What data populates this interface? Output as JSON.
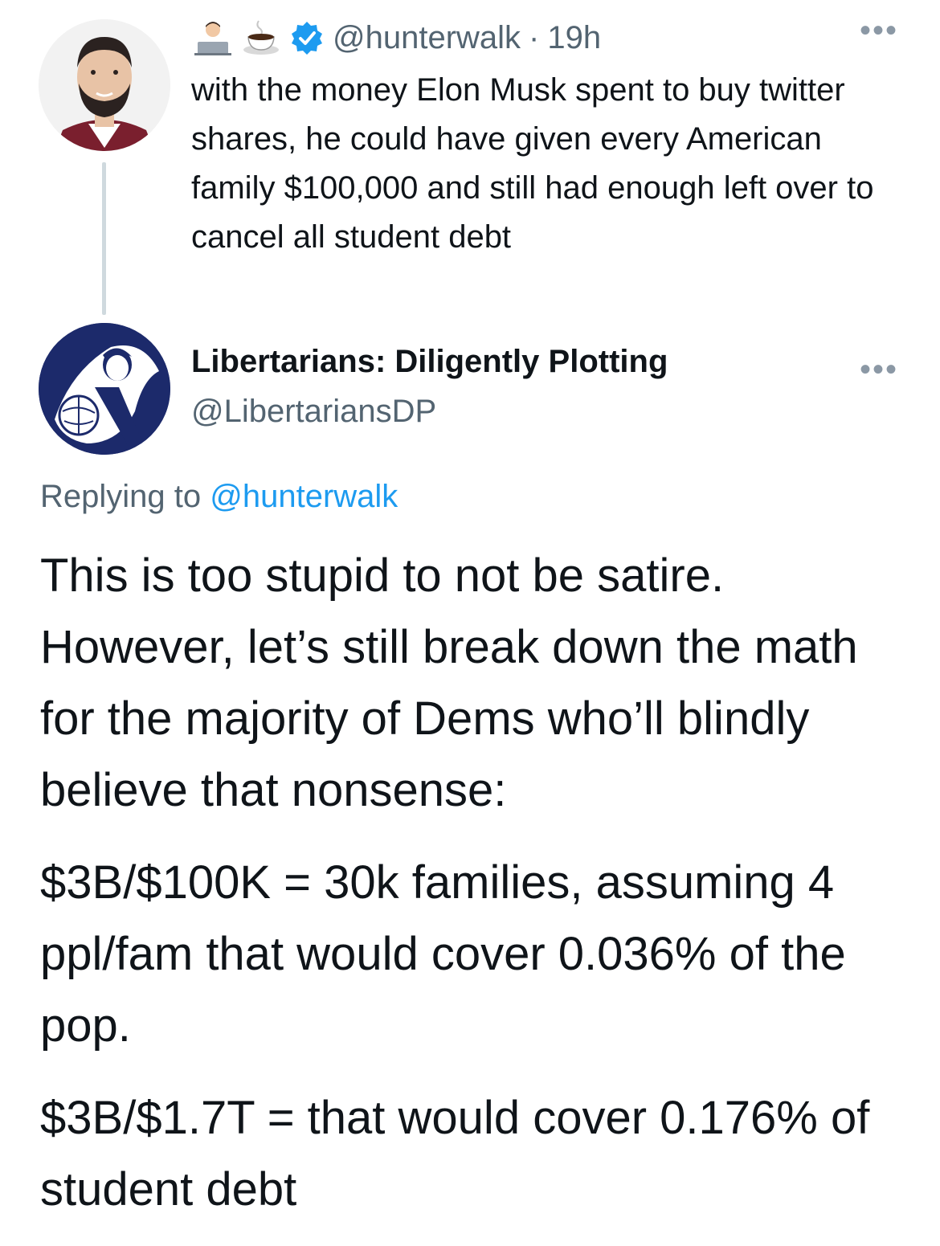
{
  "original_tweet": {
    "handle": "@hunterwalk",
    "separator": "·",
    "time": "19h",
    "text": "with the money Elon Musk spent to buy twitter shares, he could have given every American family $100,000 and still had enough left over to cancel all student debt",
    "emojis": [
      "technologist-emoji",
      "coffee-emoji"
    ],
    "more_label": "•••"
  },
  "reply": {
    "display_name": "Libertarians: Diligently Plotting",
    "handle": "@LibertariansDP",
    "more_label": "•••",
    "replying_prefix": "Replying to",
    "replying_to": "@hunterwalk",
    "paragraphs": [
      "This is too stupid to not be satire. However, let’s still break down the math for the majority of Dems who’ll blindly believe that nonsense:",
      "$3B/$100K = 30k families, assuming 4 ppl/fam that would cover 0.036% of the pop.",
      "$3B/$1.7T = that would cover 0.176% of student debt"
    ]
  },
  "colors": {
    "text": "#0f1419",
    "secondary": "#536471",
    "link": "#1d9bf0",
    "verified": "#1d9bf0",
    "thread_line": "#cfd9de"
  }
}
